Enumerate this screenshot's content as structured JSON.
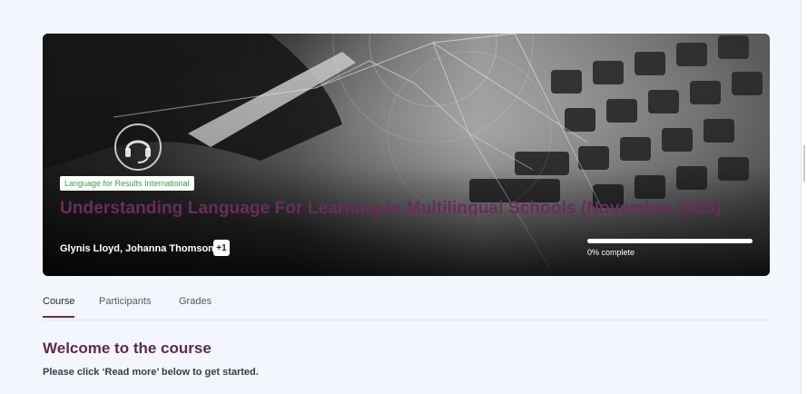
{
  "course": {
    "provider": "Language for Results International",
    "title": "Understanding Language For Learning in Multilingual Schools (November 2023)",
    "authors": "Glynis Lloyd, Johanna Thomson",
    "extra_authors": "+1",
    "progress_text": "0% complete",
    "progress_fraction": 0
  },
  "tabs": [
    {
      "label": "Course"
    },
    {
      "label": "Participants"
    },
    {
      "label": "Grades"
    }
  ],
  "welcome": {
    "title": "Welcome to the course",
    "subtitle": "Please click ‘Read more’ below to get started."
  },
  "colors": {
    "accent": "#6a2d57",
    "provider_text": "#3a9e4e",
    "page_background": "#f4f6fe"
  },
  "icons": {
    "hero_headset": "headset-icon"
  }
}
